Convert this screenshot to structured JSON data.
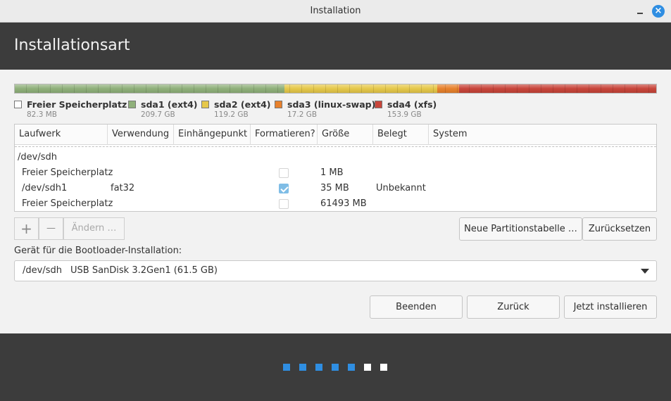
{
  "window": {
    "title": "Installation"
  },
  "header": {
    "title": "Installationsart"
  },
  "partition_bar": [
    {
      "name": "Freier Speicherplatz",
      "color": "#ffffff",
      "fraction": 0.0004
    },
    {
      "name": "sda1 (ext4)",
      "color": "#8fb07a",
      "fraction": 0.42
    },
    {
      "name": "sda2 (ext4)",
      "color": "#e6c84a",
      "fraction": 0.239
    },
    {
      "name": "sda3 (linux-swap)",
      "color": "#e8812c",
      "fraction": 0.034
    },
    {
      "name": "sda4 (xfs)",
      "color": "#c8453a",
      "fraction": 0.307
    }
  ],
  "legend": [
    {
      "name": "Freier Speicherplatz",
      "size": "82.3 MB",
      "color": "#ffffff"
    },
    {
      "name": "sda1 (ext4)",
      "size": "209.7 GB",
      "color": "#8fb07a"
    },
    {
      "name": "sda2 (ext4)",
      "size": "119.2 GB",
      "color": "#e6c84a"
    },
    {
      "name": "sda3 (linux-swap)",
      "size": "17.2 GB",
      "color": "#e8812c"
    },
    {
      "name": "sda4 (xfs)",
      "size": "153.9 GB",
      "color": "#c8453a"
    }
  ],
  "table": {
    "columns": [
      "Laufwerk",
      "Verwendung",
      "Einhängepunkt",
      "Formatieren?",
      "Größe",
      "Belegt",
      "System"
    ],
    "rows": [
      {
        "device": "/dev/sdh",
        "use": "",
        "mount": "",
        "format": null,
        "size": "",
        "used": "",
        "system": ""
      },
      {
        "device": "Freier Speicherplatz",
        "use": "",
        "mount": "",
        "format": false,
        "size": "1 MB",
        "used": "",
        "system": ""
      },
      {
        "device": "/dev/sdh1",
        "use": "fat32",
        "mount": "",
        "format": true,
        "size": "35 MB",
        "used": "Unbekannt",
        "system": ""
      },
      {
        "device": "Freier Speicherplatz",
        "use": "",
        "mount": "",
        "format": false,
        "size": "61493 MB",
        "used": "",
        "system": ""
      }
    ]
  },
  "toolbar": {
    "add": "+",
    "remove": "—",
    "change": "Ändern …"
  },
  "buttons": {
    "new_table": "Neue Partitionstabelle …",
    "reset": "Zurücksetzen",
    "quit": "Beenden",
    "back": "Zurück",
    "install": "Jetzt installieren"
  },
  "bootloader": {
    "label": "Gerät für die Bootloader-Installation:",
    "device": "/dev/sdh",
    "description": "USB  SanDisk 3.2Gen1 (61.5 GB)"
  },
  "progress": {
    "steps_total": 7,
    "steps_done": 5,
    "done_color": "#2f8ee2",
    "todo_color": "#ffffff"
  }
}
